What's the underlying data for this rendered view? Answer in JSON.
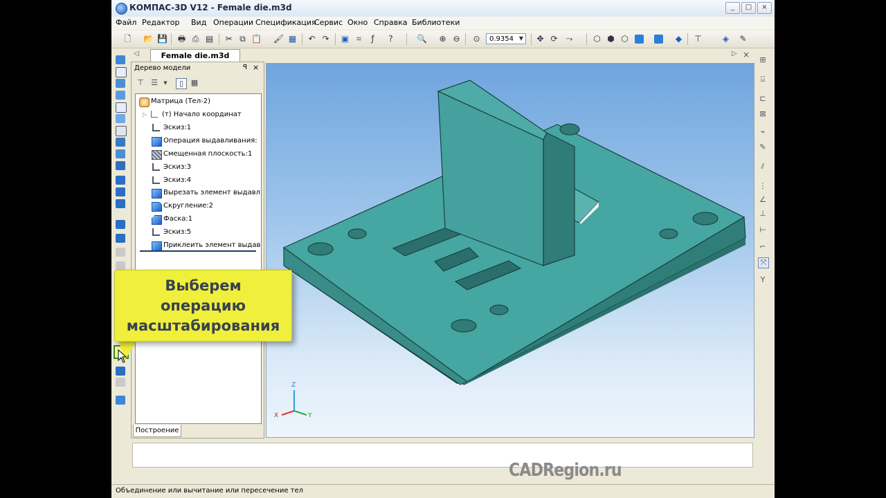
{
  "window": {
    "title": "КОМПАС-3D V12 - Female die.m3d",
    "buttons": [
      "_",
      "□",
      "×"
    ]
  },
  "menu": [
    "Файл",
    "Редактор",
    "Вид",
    "Операции",
    "Спецификация",
    "Сервис",
    "Окно",
    "Справка",
    "Библиотеки"
  ],
  "toolbar": {
    "zoom_value": "0.9354"
  },
  "document_tab": {
    "label": "Female die.m3d"
  },
  "tree_panel": {
    "title": "Дерево модели",
    "pin": "ꟼ",
    "close": "×",
    "footer_tab": "Построение",
    "nodes": [
      {
        "label": "Матрица (Тел-2)",
        "icon": "part-icon"
      },
      {
        "label": "(т) Начало координат",
        "icon": "origin-icon"
      },
      {
        "label": "Эскиз:1",
        "icon": "sketch-icon"
      },
      {
        "label": "Операция выдавливания:",
        "icon": "extrude-icon"
      },
      {
        "label": "Смещенная плоскость:1",
        "icon": "plane-icon"
      },
      {
        "label": "Эскиз:3",
        "icon": "sketch-icon"
      },
      {
        "label": "Эскиз:4",
        "icon": "sketch-icon"
      },
      {
        "label": "Вырезать элемент выдавл",
        "icon": "cut-extrude-icon"
      },
      {
        "label": "Скругление:2",
        "icon": "fillet-icon"
      },
      {
        "label": "Фаска:1",
        "icon": "chamfer-icon"
      },
      {
        "label": "Эскиз:5",
        "icon": "sketch-icon"
      },
      {
        "label": "Приклеить элемент выдав",
        "icon": "boss-extrude-icon"
      }
    ]
  },
  "axes": {
    "x": "X",
    "y": "Y",
    "z": "Z"
  },
  "callout": {
    "lines": [
      "Выберем",
      "операцию",
      "масштабирования"
    ]
  },
  "status": {
    "text": "Объединение или вычитание или пересечение тел"
  },
  "watermark": "CADRegion.ru",
  "colors": {
    "model": "#3f9a96",
    "callout": "#f0ef3c",
    "accent": "#2c7fd8"
  }
}
